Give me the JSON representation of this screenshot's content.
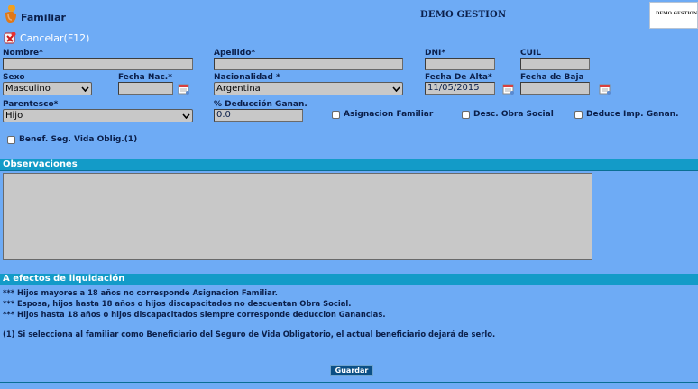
{
  "header": {
    "title": "Familiar",
    "company": "DEMO GESTION",
    "brand": "DEMO GESTION"
  },
  "toolbar": {
    "cancel_label": "Cancelar(F12)"
  },
  "form": {
    "nombre": {
      "label": "Nombre*",
      "value": ""
    },
    "apellido": {
      "label": "Apellido*",
      "value": ""
    },
    "dni": {
      "label": "DNI*",
      "value": ""
    },
    "cuil": {
      "label": "CUIL",
      "value": ""
    },
    "sexo": {
      "label": "Sexo",
      "value": "Masculino"
    },
    "fecha_nac": {
      "label": "Fecha Nac.*",
      "value": ""
    },
    "nacionalidad": {
      "label": "Nacionalidad *",
      "value": "Argentina"
    },
    "fecha_alta": {
      "label": "Fecha De Alta*",
      "value": "11/05/2015"
    },
    "fecha_baja": {
      "label": "Fecha de Baja",
      "value": ""
    },
    "parentesco": {
      "label": "Parentesco*",
      "value": "Hijo"
    },
    "deduccion": {
      "label": "% Deducción Ganan.",
      "value": "0.0"
    },
    "asignacion_familiar": {
      "label": "Asignacion Familiar",
      "checked": false
    },
    "desc_obra_social": {
      "label": "Desc. Obra Social",
      "checked": false
    },
    "deduce_imp_ganan": {
      "label": "Deduce Imp. Ganan.",
      "checked": false
    },
    "benef_seg_vida": {
      "label": "Benef. Seg. Vida Oblig.(1)",
      "checked": false
    }
  },
  "observaciones": {
    "title": "Observaciones",
    "value": ""
  },
  "liquidacion": {
    "title": "A efectos de liquidación",
    "notes": [
      "*** Hijos mayores a 18 años no corresponde Asignacion Familiar.",
      "*** Esposa, hijos hasta 18 años o hijos discapacitados no descuentan Obra Social.",
      "*** Hijos hasta 18 años o hijos discapacitados siempre corresponde deduccion Ganancias.",
      "(1) Si selecciona al familiar como Beneficiario del Seguro de Vida Obligatorio, el actual beneficiario dejará de serlo."
    ]
  },
  "actions": {
    "save_label": "Guardar"
  },
  "colors": {
    "background": "#6eabf5",
    "section_header": "#139bc8",
    "input": "#c8c8c8",
    "button": "#0a4f86"
  },
  "icons": [
    "app-logo-icon",
    "cancel-icon",
    "calendar-icon",
    "chevron-down-icon"
  ]
}
